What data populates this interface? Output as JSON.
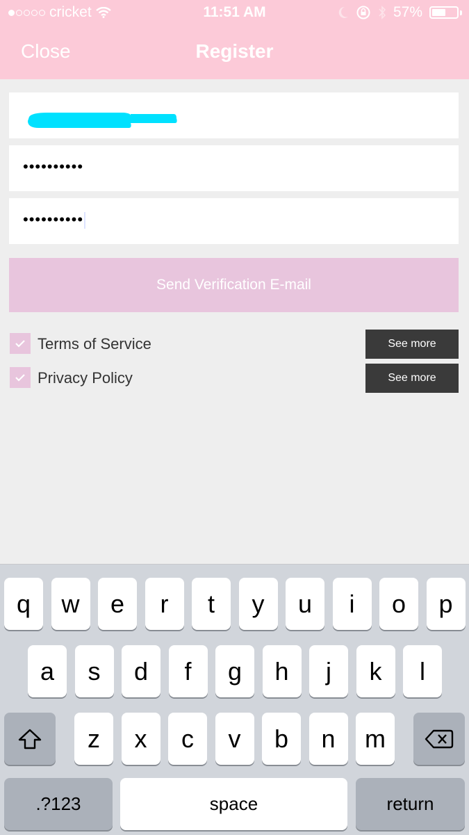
{
  "status_bar": {
    "signal_bars_filled": 1,
    "signal_bars_total": 5,
    "carrier": "cricket",
    "time": "11:51 AM",
    "battery_percent": "57%",
    "battery_level": 0.57,
    "icons": [
      "wifi-icon",
      "moon-icon",
      "rotation-lock-icon",
      "bluetooth-icon",
      "battery-icon"
    ]
  },
  "nav": {
    "close_label": "Close",
    "title": "Register"
  },
  "form": {
    "email_value_redacted": true,
    "password_mask": "••••••••••",
    "confirm_password_mask": "••••••••••",
    "send_button_label": "Send Verification E-mail"
  },
  "agreements": [
    {
      "label": "Terms of Service",
      "checked": true,
      "button_label": "See more"
    },
    {
      "label": "Privacy Policy",
      "checked": true,
      "button_label": "See more"
    }
  ],
  "keyboard": {
    "row1": [
      "q",
      "w",
      "e",
      "r",
      "t",
      "y",
      "u",
      "i",
      "o",
      "p"
    ],
    "row2": [
      "a",
      "s",
      "d",
      "f",
      "g",
      "h",
      "j",
      "k",
      "l"
    ],
    "row3": [
      "z",
      "x",
      "c",
      "v",
      "b",
      "n",
      "m"
    ],
    "numbers_label": ".?123",
    "space_label": "space",
    "return_label": "return"
  },
  "colors": {
    "header_pink": "#fccad8",
    "button_pink": "#e8c5dd",
    "dark_button": "#3a3a3a",
    "redaction_cyan": "#00e1ff"
  }
}
